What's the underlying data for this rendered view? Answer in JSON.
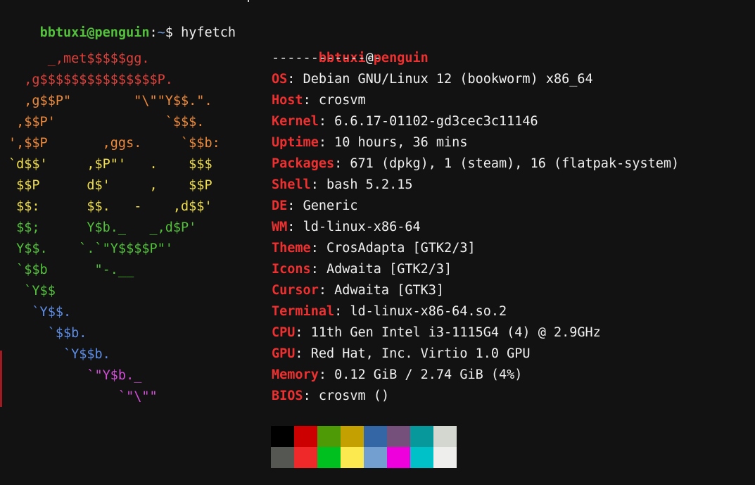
{
  "prompt": {
    "user_host": "bbtuxi@penguin",
    "colon": ":",
    "path": "~",
    "symbol": "$ ",
    "command": "hyfetch"
  },
  "logo": {
    "colors": [
      "#e0413b",
      "#ee8a3a",
      "#f1df4c",
      "#53c13b",
      "#5e8ee8",
      "#d24fd8"
    ],
    "lines": [
      {
        "text": "     _,met$$$$$gg.",
        "color_index": 0
      },
      {
        "text": "  ,g$$$$$$$$$$$$$$$P.",
        "color_index": 0
      },
      {
        "text": "  ,g$$P\"        \"\\\"\"Y$$.\".",
        "color_index": 1
      },
      {
        "text": " ,$$P'              `$$$.",
        "color_index": 1
      },
      {
        "text": "',$$P       ,ggs.     `$$b:",
        "color_index": 1
      },
      {
        "text": "`d$$'     ,$P\"'   .    $$$",
        "color_index": 2
      },
      {
        "text": " $$P      d$'     ,    $$P",
        "color_index": 2
      },
      {
        "text": " $$:      $$.   -    ,d$$'",
        "color_index": 2
      },
      {
        "text": " $$;      Y$b._   _,d$P'",
        "color_index": 3
      },
      {
        "text": " Y$$.    `.`\"Y$$$$P\"'",
        "color_index": 3
      },
      {
        "text": " `$$b      \"-.__",
        "color_index": 3
      },
      {
        "text": "  `Y$$",
        "color_index": 3
      },
      {
        "text": "   `Y$$.",
        "color_index": 4
      },
      {
        "text": "     `$$b.",
        "color_index": 4
      },
      {
        "text": "       `Y$$b.",
        "color_index": 4
      },
      {
        "text": "          `\"Y$b._",
        "color_index": 5
      },
      {
        "text": "              `\"\\\"\"",
        "color_index": 5
      }
    ]
  },
  "info": {
    "title": {
      "user": "bbtuxi",
      "at": "@",
      "host": "penguin"
    },
    "separator": "--------------",
    "rows": [
      {
        "key": "OS",
        "value": "Debian GNU/Linux 12 (bookworm) x86_64"
      },
      {
        "key": "Host",
        "value": "crosvm"
      },
      {
        "key": "Kernel",
        "value": "6.6.17-01102-gd3cec3c11146"
      },
      {
        "key": "Uptime",
        "value": "10 hours, 36 mins"
      },
      {
        "key": "Packages",
        "value": "671 (dpkg), 1 (steam), 16 (flatpak-system)"
      },
      {
        "key": "Shell",
        "value": "bash 5.2.15"
      },
      {
        "key": "DE",
        "value": "Generic"
      },
      {
        "key": "WM",
        "value": "ld-linux-x86-64"
      },
      {
        "key": "Theme",
        "value": "CrosAdapta [GTK2/3]"
      },
      {
        "key": "Icons",
        "value": "Adwaita [GTK2/3]"
      },
      {
        "key": "Cursor",
        "value": "Adwaita [GTK3]"
      },
      {
        "key": "Terminal",
        "value": "ld-linux-x86-64.so.2"
      },
      {
        "key": "CPU",
        "value": "11th Gen Intel i3-1115G4 (4) @ 2.9GHz"
      },
      {
        "key": "GPU",
        "value": "Red Hat, Inc. Virtio 1.0 GPU"
      },
      {
        "key": "Memory",
        "value": "0.12 GiB / 2.74 GiB (4%)"
      },
      {
        "key": "BIOS",
        "value": "crosvm ()"
      }
    ],
    "key_suffix": ": "
  },
  "palette": {
    "normal": [
      "#000000",
      "#cc0000",
      "#4e9a06",
      "#c4a000",
      "#3465a4",
      "#75507b",
      "#06989a",
      "#d3d7cf"
    ],
    "bright": [
      "#555753",
      "#ef2929",
      "#00c020",
      "#fce94f",
      "#729fcf",
      "#ee00dd",
      "#00c0c8",
      "#eeeeec"
    ]
  }
}
